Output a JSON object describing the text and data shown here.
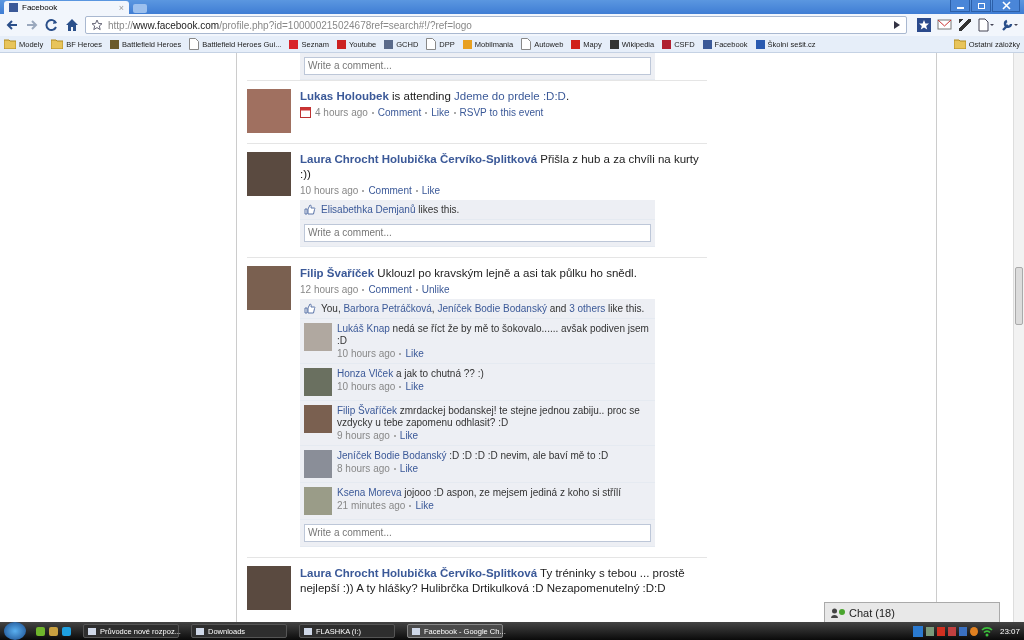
{
  "browser": {
    "tab": {
      "title": "Facebook",
      "close": "×"
    },
    "url": {
      "scheme": "http://",
      "host": "www.facebook.com",
      "path": "/profile.php?id=100000215024678ref=search#!/?ref=logo"
    }
  },
  "bookmarks": [
    {
      "label": "Modely",
      "kind": "folder"
    },
    {
      "label": "BF Heroes",
      "kind": "folder"
    },
    {
      "label": "Battlefield Heroes",
      "kind": "site",
      "color": "#6b5a2a"
    },
    {
      "label": "Battlefield Heroes Gui...",
      "kind": "page"
    },
    {
      "label": "Seznam",
      "kind": "site",
      "color": "#d8232a"
    },
    {
      "label": "Youtube",
      "kind": "site",
      "color": "#cc2222"
    },
    {
      "label": "GCHD",
      "kind": "site",
      "color": "#5a6a8a"
    },
    {
      "label": "DPP",
      "kind": "page"
    },
    {
      "label": "Mobilmania",
      "kind": "site",
      "color": "#e8a020"
    },
    {
      "label": "Autoweb",
      "kind": "page"
    },
    {
      "label": "Mapy",
      "kind": "site",
      "color": "#d0201a"
    },
    {
      "label": "Wikipedia",
      "kind": "site",
      "color": "#333333"
    },
    {
      "label": "CSFD",
      "kind": "site",
      "color": "#b02030"
    },
    {
      "label": "Facebook",
      "kind": "site",
      "color": "#3b5998"
    },
    {
      "label": "Školní sešit.cz",
      "kind": "site",
      "color": "#2a5ab0"
    }
  ],
  "other_bookmarks": "Ostatní záložky",
  "feed": {
    "top_comment_box": {
      "placeholder": "Write a comment..."
    },
    "posts": [
      {
        "author": "Lukas Holoubek",
        "text": "is attending",
        "event": "Jdeme do prdele :D:D",
        "end": ".",
        "event_icon": true,
        "time": "4 hours ago",
        "actions": [
          "Comment",
          "Like",
          "RSVP to this event"
        ]
      },
      {
        "author": "Laura Chrocht Holubička Červíko-Splitková",
        "text": "Přišla z hub a za chvíli na kurty :))",
        "event_icon": false,
        "time": "10 hours ago",
        "actions": [
          "Comment",
          "Like"
        ],
        "likes": [
          {
            "text": "Elisabethka Demjanů",
            "link": true
          },
          {
            "text": " likes this.",
            "link": false
          }
        ],
        "comment_box": {
          "placeholder": "Write a comment..."
        }
      },
      {
        "author": "Filip Švaříček",
        "text": "Uklouzl po kravským lejně a asi tak půlku ho snědl.",
        "event_icon": false,
        "time": "12 hours ago",
        "actions": [
          "Comment",
          "Unlike"
        ],
        "likes": [
          {
            "text": "You, ",
            "link": false
          },
          {
            "text": "Barbora Petráčková",
            "link": true
          },
          {
            "text": ", ",
            "link": false
          },
          {
            "text": "Jeníček Bodie Bodanský",
            "link": true
          },
          {
            "text": " and ",
            "link": false
          },
          {
            "text": "3 others",
            "link": true
          },
          {
            "text": " like this.",
            "link": false
          }
        ],
        "comments": [
          {
            "author": "Lukáš Knap",
            "text": "nedá se říct že by mě to šokovalo...... avšak podiven jsem :D",
            "time": "10 hours ago",
            "action": "Like"
          },
          {
            "author": "Honza Vlček",
            "text": "a jak to chutná ?? :)",
            "time": "10 hours ago",
            "action": "Like"
          },
          {
            "author": "Filip Švaříček",
            "text": "zmrdackej bodanskej! te stejne jednou zabiju.. proc se vzdycky u tebe zapomenu odhlasit? :D",
            "time": "9 hours ago",
            "action": "Like"
          },
          {
            "author": "Jeníček Bodie Bodanský",
            "text": ":D :D :D :D nevim, ale baví mě to :D",
            "time": "8 hours ago",
            "action": "Like"
          },
          {
            "author": "Ksena Moreva",
            "text": "jojooo :D aspon, ze mejsem jediná z koho si střílí",
            "time": "21 minutes ago",
            "action": "Like"
          }
        ],
        "comment_box": {
          "placeholder": "Write a comment..."
        }
      },
      {
        "author": "Laura Chrocht Holubička Červíko-Splitková",
        "text": "Ty tréninky s tebou ... prostě nejlepší :)) A ty hlášky? Hulibrčka Drtikulková :D Nezapomenutelný :D:D"
      }
    ]
  },
  "chat": {
    "label": "Chat (18)"
  },
  "taskbar": {
    "tasks": [
      {
        "label": "Průvodce nové rozpoz...",
        "selected": false
      },
      {
        "label": "Downloads",
        "selected": false
      },
      {
        "label": "FLASHKA (I:)",
        "selected": false
      },
      {
        "label": "Facebook - Google Ch...",
        "selected": true
      }
    ],
    "clock": "23:07"
  }
}
